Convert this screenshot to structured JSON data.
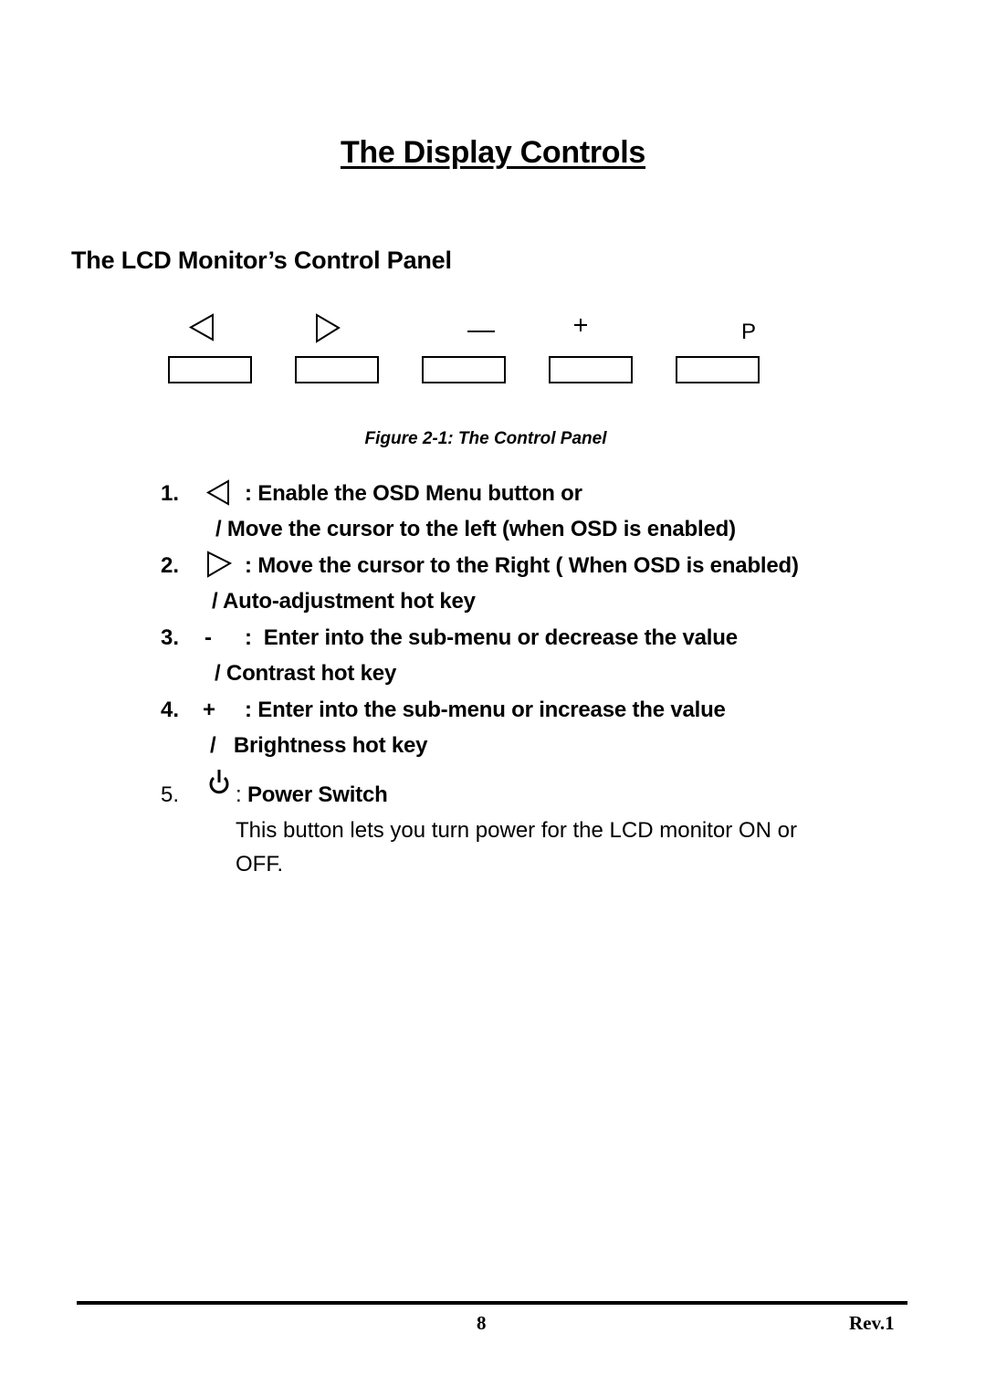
{
  "page": {
    "title": "The Display Controls",
    "section_heading": "The LCD Monitor’s Control Panel"
  },
  "control_panel": {
    "buttons": [
      {
        "icon": "left-triangle-icon",
        "label": "◁"
      },
      {
        "icon": "right-triangle-icon",
        "label": "▷"
      },
      {
        "icon": "minus-icon",
        "label": "—"
      },
      {
        "icon": "plus-icon",
        "label": "+"
      },
      {
        "icon": "power-p-icon",
        "label": "P"
      }
    ],
    "caption": "Figure 2-1: The Control Panel"
  },
  "items": [
    {
      "number": "1.",
      "symbol": "left-triangle-icon",
      "text": ": Enable the OSD Menu button or",
      "continuation": "/ Move the cursor to the left (when OSD is enabled)"
    },
    {
      "number": "2.",
      "symbol": "right-triangle-icon",
      "text": ": Move the cursor to the Right ( When OSD is enabled)",
      "continuation": "/ Auto-adjustment hot key"
    },
    {
      "number": "3.",
      "symbol_text": "-",
      "text": ":  Enter into the sub-menu or decrease the value",
      "continuation": "/ Contrast hot key"
    },
    {
      "number": "4.",
      "symbol_text": "+",
      "text": ": Enter into the sub-menu or increase the value",
      "continuation": "/   Brightness hot key"
    },
    {
      "number": "5.",
      "symbol": "power-icon",
      "text_prefix": ": ",
      "text": "Power Switch",
      "description_line1": "This button lets you turn power for the LCD monitor ON or",
      "description_line2": "OFF."
    }
  ],
  "footer": {
    "page_number": "8",
    "revision": "Rev.1"
  }
}
